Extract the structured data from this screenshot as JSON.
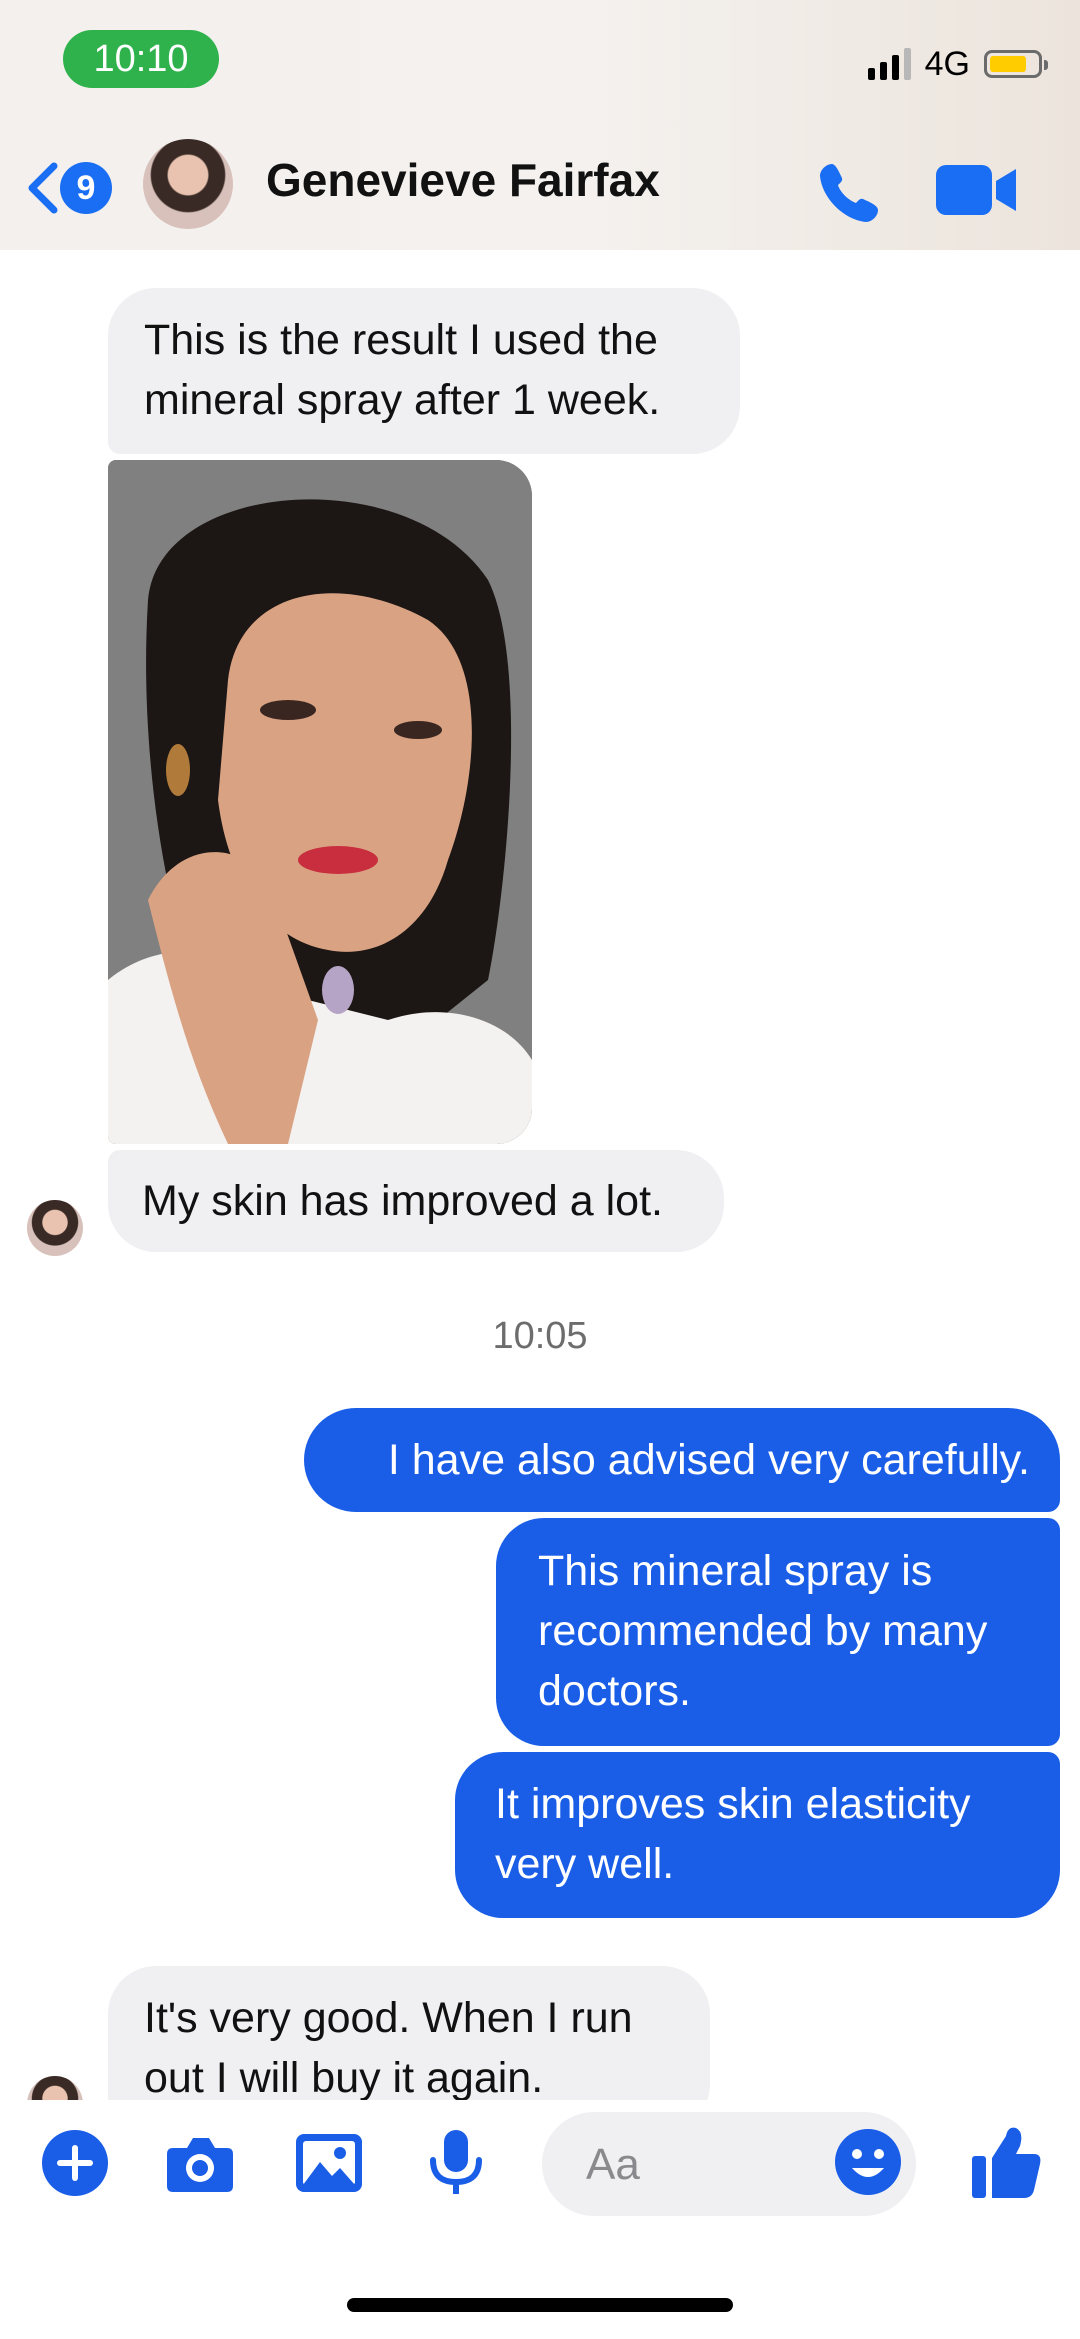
{
  "status_bar": {
    "time": "10:10",
    "network": "4G",
    "battery_color": "#ffcc00"
  },
  "header": {
    "unread_count": "9",
    "contact_name": "Genevieve Fairfax",
    "icons": [
      "back-chevron-icon",
      "phone-icon",
      "video-camera-icon"
    ],
    "accent_color": "#1a6ef3"
  },
  "messages": [
    {
      "from": "contact",
      "type": "text",
      "text": "This is the result I used the mineral spray after 1 week."
    },
    {
      "from": "contact",
      "type": "image"
    },
    {
      "from": "contact",
      "type": "text",
      "text": "My skin has improved a lot."
    },
    {
      "type": "timestamp",
      "text": "10:05"
    },
    {
      "from": "me",
      "type": "text",
      "text": "I have also advised very carefully."
    },
    {
      "from": "me",
      "type": "text",
      "text": "This mineral spray is recommended by many doctors."
    },
    {
      "from": "me",
      "type": "text",
      "text": "It improves skin elasticity very well."
    },
    {
      "from": "contact",
      "type": "text",
      "text": "It's very good. When I run out I will buy it again."
    }
  ],
  "composer": {
    "placeholder": "Aa",
    "icons": [
      "plus-icon",
      "camera-icon",
      "gallery-icon",
      "microphone-icon",
      "emoji-icon",
      "thumbs-up-icon"
    ]
  },
  "colors": {
    "outgoing_bubble": "#1a5ee8",
    "incoming_bubble": "#f0f0f2"
  }
}
